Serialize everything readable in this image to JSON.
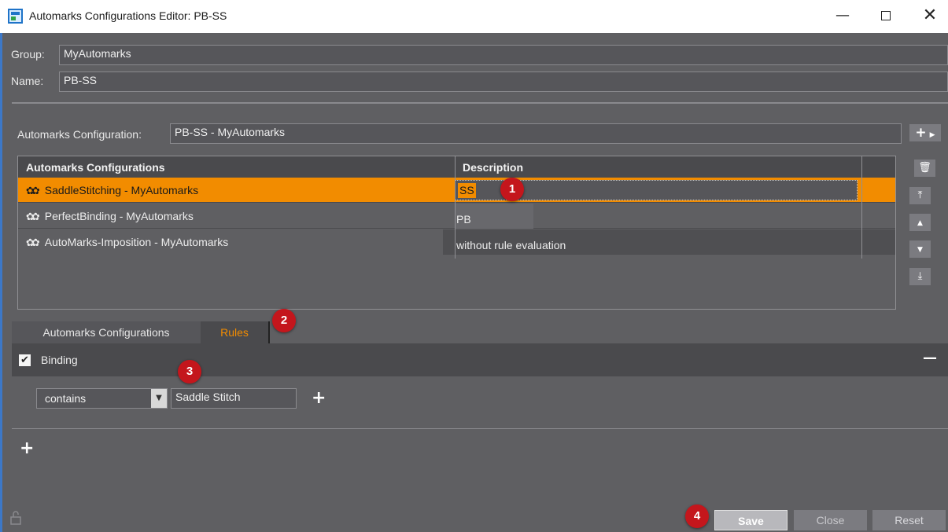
{
  "window": {
    "title": "Automarks Configurations Editor: PB-SS",
    "minimize": "—",
    "close": "✕"
  },
  "form": {
    "group_label": "Group:",
    "group_value": "MyAutomarks",
    "name_label": "Name:",
    "name_value": "PB-SS",
    "config_label": "Automarks Configuration:",
    "config_value": "PB-SS - MyAutomarks"
  },
  "table": {
    "columns": [
      "Automarks Configurations",
      "Description"
    ],
    "rows": [
      {
        "name": "SaddleStitching - MyAutomarks",
        "description": "SS",
        "selected": true
      },
      {
        "name": "PerfectBinding - MyAutomarks",
        "description": "PB",
        "selected": false
      },
      {
        "name": "AutoMarks-Imposition - MyAutomarks",
        "description": "without rule evaluation",
        "selected": false
      }
    ]
  },
  "tabs": [
    {
      "label": "Automarks Configurations",
      "active": false
    },
    {
      "label": "Rules",
      "active": true
    }
  ],
  "rules": {
    "checkbox_checked": true,
    "checkbox_glyph": "✔",
    "binding_label": "Binding",
    "collapse_glyph": "—",
    "condition_operator": "contains",
    "condition_value": "Saddle Stitch",
    "add_glyph": "+"
  },
  "badges": [
    "1",
    "2",
    "3",
    "4"
  ],
  "buttons": {
    "save": "Save",
    "close": "Close",
    "reset": "Reset"
  },
  "side_buttons": {
    "add": "+",
    "delete": "🗑",
    "top": "⤒",
    "up": "▲",
    "down": "▼",
    "bottom": "⤓"
  },
  "colors": {
    "accent": "#f28c00",
    "badge": "#c4161c",
    "panel": "#5f5f62"
  }
}
